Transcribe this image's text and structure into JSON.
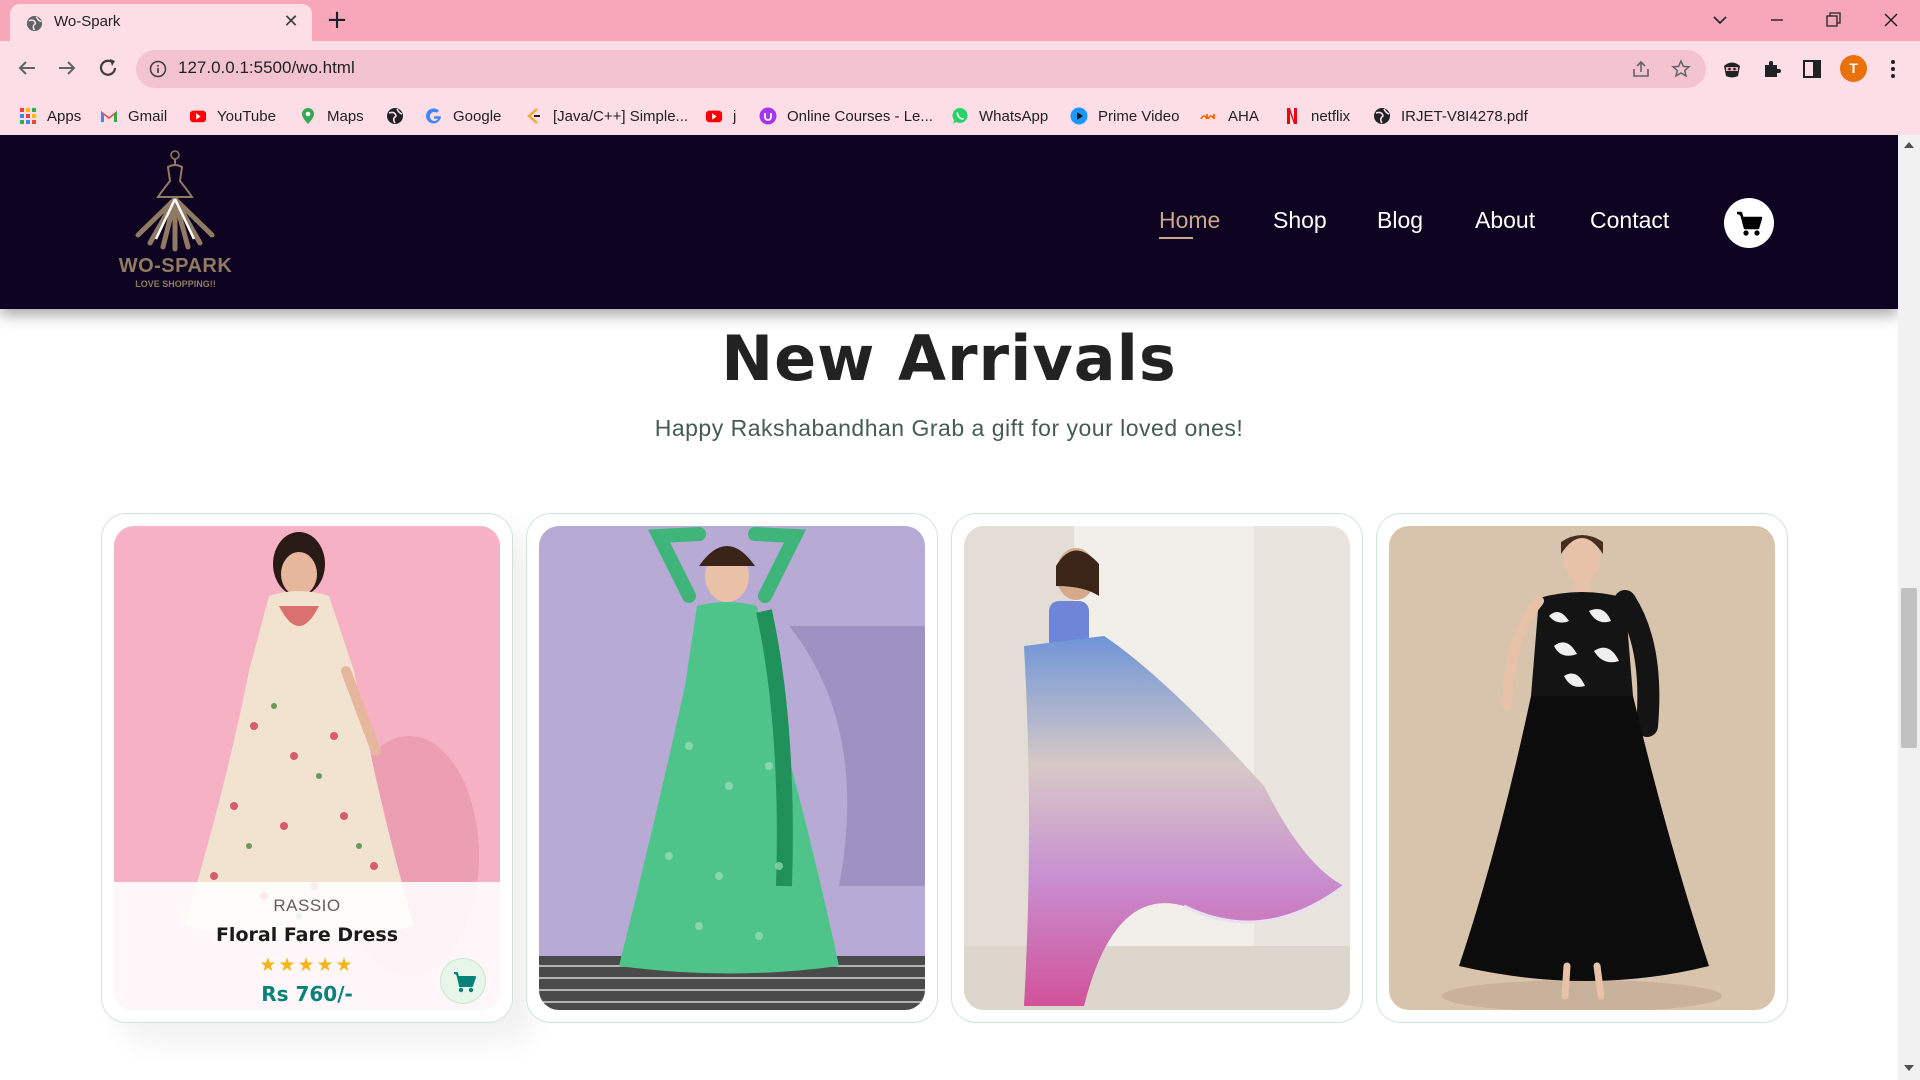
{
  "browser": {
    "tab_title": "Wo-Spark",
    "url": "127.0.0.1:5500/wo.html",
    "profile_initial": "T",
    "bookmarks": [
      {
        "label": "Apps",
        "icon": "apps-grid-icon"
      },
      {
        "label": "Gmail",
        "icon": "gmail-icon"
      },
      {
        "label": "YouTube",
        "icon": "youtube-icon"
      },
      {
        "label": "Maps",
        "icon": "maps-pin-icon"
      },
      {
        "label": "",
        "icon": "globe-icon"
      },
      {
        "label": "Google",
        "icon": "google-icon"
      },
      {
        "label": "[Java/C++] Simple...",
        "icon": "codeforces-icon"
      },
      {
        "label": "j",
        "icon": "youtube-icon"
      },
      {
        "label": "Online Courses - Le...",
        "icon": "udemy-icon"
      },
      {
        "label": "WhatsApp",
        "icon": "whatsapp-icon"
      },
      {
        "label": "Prime Video",
        "icon": "prime-video-icon"
      },
      {
        "label": "AHA",
        "icon": "aha-icon"
      },
      {
        "label": "netflix",
        "icon": "netflix-icon"
      },
      {
        "label": "IRJET-V8I4278.pdf",
        "icon": "globe-icon"
      }
    ]
  },
  "site": {
    "logo_name": "WO-SPARK",
    "logo_tagline": "LOVE SHOPPING!!",
    "nav": [
      "Home",
      "Shop",
      "Blog",
      "About",
      "Contact"
    ],
    "active_nav": "Home"
  },
  "section": {
    "title": "New Arrivals",
    "subtitle": "Happy Rakshabandhan Grab a gift for your loved ones!"
  },
  "products": [
    {
      "brand": "RASSIO",
      "name": "Floral Fare Dress",
      "stars": "★★★★★",
      "rating": 5,
      "price": "Rs 760/-",
      "image": "floral-dress-model"
    },
    {
      "image": "green-anarkali-model"
    },
    {
      "image": "ombre-saree-model"
    },
    {
      "image": "black-gown-model"
    }
  ],
  "colors": {
    "tabbar": "#f8a7bb",
    "toolbar": "#fddde6",
    "header": "#0e0321",
    "accent_gold": "#c9a88a",
    "price_green": "#088178",
    "star_yellow": "#f3b519"
  }
}
